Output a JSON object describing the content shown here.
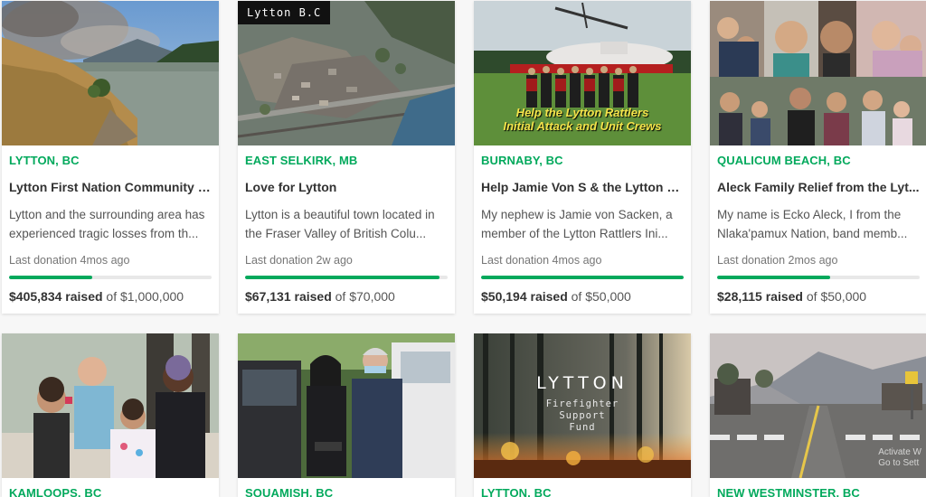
{
  "cards": [
    {
      "location": "LYTTON, BC",
      "title": "Lytton First Nation Community E...",
      "description": "Lytton and the surrounding area has experienced tragic losses from th...",
      "last_donation": "Last donation 4mos ago",
      "raised": "$405,834 raised",
      "goal": "of $1,000,000",
      "progress": 0.41,
      "image": "wildfire-river-photo"
    },
    {
      "location": "EAST SELKIRK, MB",
      "title": "Love for Lytton",
      "description": "Lytton is a beautiful town located in the Fraser Valley of British Colu...",
      "last_donation": "Last donation 2w ago",
      "raised": "$67,131 raised",
      "goal": "of $70,000",
      "progress": 0.96,
      "image": "aerial-burned-town-photo",
      "image_tag": "Lytton B.C"
    },
    {
      "location": "BURNABY, BC",
      "title": "Help Jamie Von S & the Lytton R...",
      "description": "My nephew is Jamie von Sacken, a member of the Lytton Rattlers Ini...",
      "last_donation": "Last donation 4mos ago",
      "raised": "$50,194 raised",
      "goal": "of $50,000",
      "progress": 1.0,
      "image": "firefighter-crew-helicopter-photo",
      "image_text": [
        "Help the Lytton Rattlers",
        "Initial Attack and Unit Crews"
      ]
    },
    {
      "location": "QUALICUM BEACH, BC",
      "title": "Aleck Family Relief from the Lyt...",
      "description": "My name is Ecko Aleck, I from the Nlaka'pamux Nation, band memb...",
      "last_donation": "Last donation 2mos ago",
      "raised": "$28,115 raised",
      "goal": "of $50,000",
      "progress": 0.56,
      "image": "family-collage-photo"
    },
    {
      "location": "KAMLOOPS, BC",
      "image": "family-forest-photo"
    },
    {
      "location": "SQUAMISH, BC",
      "image": "couple-by-truck-photo"
    },
    {
      "location": "LYTTON, BC",
      "image": "burning-forest-poster",
      "image_title": "LYTTON",
      "image_sub": [
        "Firefighter",
        "Support",
        "Fund"
      ]
    },
    {
      "location": "NEW WESTMINSTER, BC",
      "image": "smoky-street-photo",
      "watermark": [
        "Activate W",
        "Go to Sett"
      ]
    }
  ],
  "colors": {
    "accent": "#02a95c",
    "text": "#333333"
  }
}
